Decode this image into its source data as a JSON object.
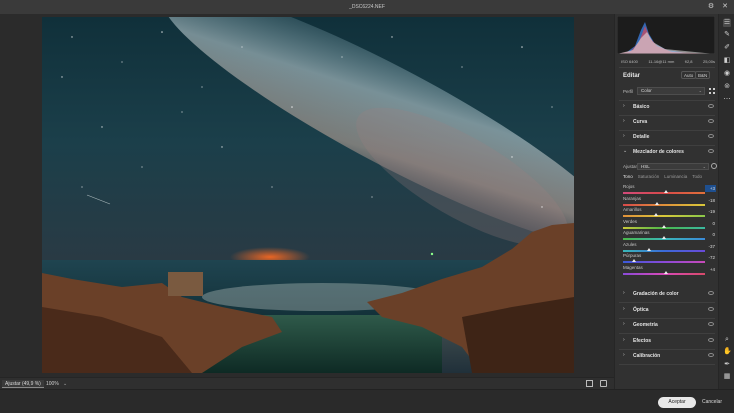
{
  "window": {
    "title": "_DSC6224.NEF"
  },
  "status": {
    "fit_label": "Ajustar (49,9 %)",
    "zoom_100": "100%",
    "zoom_arrow": "⌄"
  },
  "exif": {
    "iso": "ISO 6400",
    "lens": "11-16@11 mm",
    "aperture": "f/2,8",
    "shutter": "25,00s"
  },
  "editor": {
    "title": "Editar",
    "auto_label": "Auto",
    "bw_label": "B&N",
    "profile_label": "Perfil",
    "profile_value": "Color"
  },
  "sections_top": [
    {
      "label": "Básico"
    },
    {
      "label": "Curva"
    },
    {
      "label": "Detalle"
    }
  ],
  "mixer": {
    "label": "Mezclador de colores",
    "adjust_label": "Ajustar",
    "adjust_value": "HSL",
    "tabs": [
      "Tono",
      "Saturación",
      "Luminancia",
      "Todo"
    ],
    "active_tab": "Tono",
    "sliders": [
      {
        "name": "Rojos",
        "value": "+3",
        "pos": 0.53,
        "gradient": "#d24a7a,#d84a4a,#e0703a"
      },
      {
        "name": "Naranjas",
        "value": "-18",
        "pos": 0.41,
        "gradient": "#d84a4a,#e0903a,#d8c83a"
      },
      {
        "name": "Amarillos",
        "value": "-19",
        "pos": 0.4,
        "gradient": "#e0903a,#d8c83a,#8ac84a"
      },
      {
        "name": "Verdes",
        "value": "0",
        "pos": 0.5,
        "gradient": "#c8c83a,#4ab84a,#3ab8a0"
      },
      {
        "name": "Aguamarinas",
        "value": "0",
        "pos": 0.5,
        "gradient": "#4ab84a,#3ab8b8,#3a8ad8"
      },
      {
        "name": "Azules",
        "value": "-37",
        "pos": 0.32,
        "gradient": "#3ab8b8,#3a6ad8,#6a4ad8"
      },
      {
        "name": "Púrpuras",
        "value": "-72",
        "pos": 0.14,
        "gradient": "#3a5ad8,#8a4ad8,#c84ab8"
      },
      {
        "name": "Magentas",
        "value": "+4",
        "pos": 0.52,
        "gradient": "#8a4ad8,#d84ab8,#d84a6a"
      }
    ]
  },
  "sections_bottom": [
    {
      "label": "Gradación de color"
    },
    {
      "label": "Óptica"
    },
    {
      "label": "Geometría"
    },
    {
      "label": "Efectos"
    },
    {
      "label": "Calibración"
    }
  ],
  "buttons": {
    "accept": "Aceptar",
    "cancel": "Cancelar"
  },
  "icons": {
    "close": "close-icon",
    "settings": "gear-icon",
    "tools": [
      "edit-icon",
      "heal-icon",
      "mask-icon",
      "redeye-icon",
      "presets-icon",
      "more-icon",
      "zoom-icon",
      "hand-icon",
      "sampler-icon",
      "grid-overlay-icon"
    ]
  }
}
